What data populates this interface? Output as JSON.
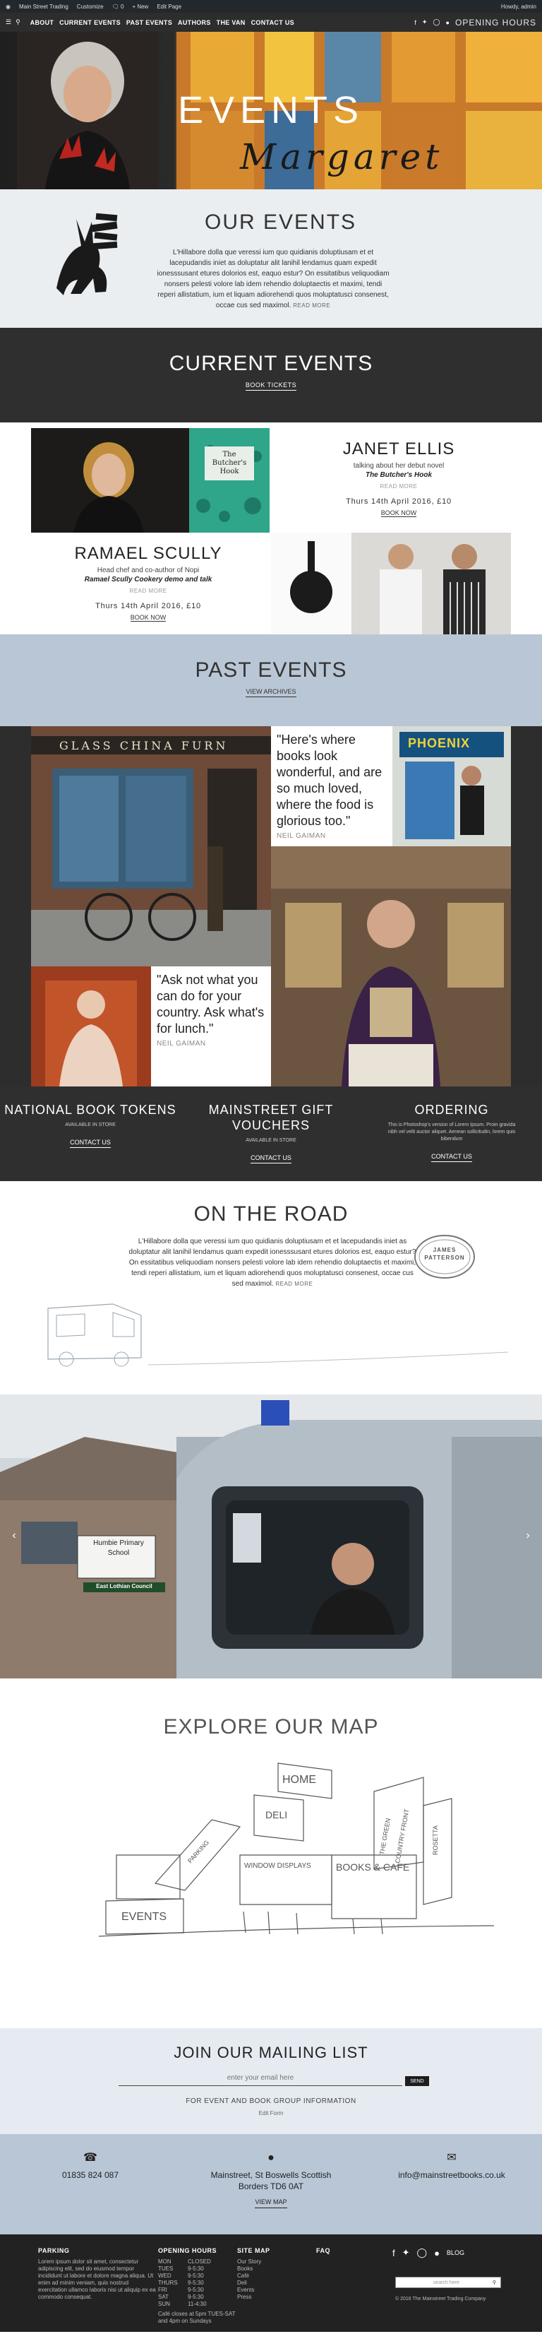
{
  "adminbar": {
    "site": "Main Street Trading",
    "customize": "Customize",
    "comments": "0",
    "new": "+ New",
    "edit": "Edit Page",
    "howdy": "Howdy, admin"
  },
  "nav": {
    "items": [
      "ABOUT",
      "CURRENT EVENTS",
      "PAST EVENTS",
      "AUTHORS",
      "THE VAN",
      "CONTACT US"
    ],
    "hours": "OPENING HOURS"
  },
  "hero": {
    "title": "EVENTS",
    "script": "Margaret"
  },
  "our_events": {
    "title": "OUR EVENTS",
    "body": "L'Hillabore dolla que veressi ium quo quidianis doluptiusam et et lacepudandis iniet as doluptatur alit lanihil lendamus quam expedit ionesssusant etures dolorios est, eaquo estur? On essitatibus veliquodiam nonsers pelesti volore lab idem rehendio doluptaectis et maximi, tendi reperi allistatium, ium et liquam adiorehendi quos moluptatusci consenest, occae cus sed maximol.",
    "read_more": "READ MORE"
  },
  "current": {
    "title": "CURRENT EVENTS",
    "link": "BOOK TICKETS",
    "events": [
      {
        "name": "JANET ELLIS",
        "sub": "talking about her debut novel",
        "book": "The Butcher's Hook",
        "more": "READ MORE",
        "date": "Thurs 14th April 2016, £10",
        "book_now": "BOOK NOW",
        "cover": "The Butcher's Hook"
      },
      {
        "name": "RAMAEL SCULLY",
        "sub": "Head chef and co-author of Nopi",
        "book": "Ramael Scully Cookery demo and talk",
        "more": "READ MORE",
        "date": "Thurs 14th April 2016, £10",
        "book_now": "BOOK NOW"
      }
    ]
  },
  "past": {
    "title": "PAST EVENTS",
    "link": "VIEW ARCHIVES",
    "quotes": [
      {
        "q": "\"Here's where books look wonderful, and are so much loved, where the food is glorious too.\"",
        "who": "NEIL GAIMAN"
      },
      {
        "q": "\"Ask not what you can do for your country. Ask what's for lunch.\"",
        "who": "NEIL GAIMAN"
      }
    ],
    "shop_sign": "GLASS CHINA FURN",
    "phoenix": "PHOENIX"
  },
  "tokens": [
    {
      "title": "NATIONAL BOOK TOKENS",
      "small": "AVAILABLE IN STORE",
      "contact": "CONTACT US"
    },
    {
      "title": "MAINSTREET GIFT VOUCHERS",
      "small": "AVAILABLE IN STORE",
      "contact": "CONTACT US"
    },
    {
      "title": "ORDERING",
      "small": "This is Photoshop's version of Lorem Ipsum. Proin gravida nibh vel velit auctor aliquet. Aenean sollicitudin, lorem quis bibendum",
      "contact": "CONTACT US"
    }
  ],
  "road": {
    "title": "ON THE ROAD",
    "body": "L'Hillabore dolla que veressi ium quo quidianis doluptiusam et et lacepudandis iniet as doluptatur alit lanihil lendamus quam expedit ionesssusant etures dolorios est, eaquo estur? On essitatibus veliquodiam nonsers pelesti volore lab idem rehendio doluptaectis et maximi, tendi reperi allistatium, ium et liquam adiorehendi quos moluptatusci consenest, occae cus sed maximol.",
    "read_more": "READ MORE",
    "stamp": "JAMES PATTERSON",
    "school_sign": "Humbie Primary School",
    "council_sign": "East Lothian Council"
  },
  "map": {
    "title": "EXPLORE OUR MAP",
    "labels": [
      "HOME",
      "DELI",
      "WINDOW DISPLAYS",
      "BOOKS & CAFE",
      "EVENTS",
      "PARKING",
      "THE GREEN",
      "COUNTRY FRONT",
      "ROSETTA"
    ]
  },
  "mailing": {
    "title": "JOIN OUR MAILING LIST",
    "placeholder": "enter your email here",
    "send": "SEND",
    "group": "FOR EVENT AND BOOK GROUP INFORMATION",
    "edit": "Edit Form"
  },
  "contact": {
    "phone": "01835 824 087",
    "address1": "Mainstreet, St Boswells Scottish",
    "address2": "Borders TD6 0AT",
    "view_map": "VIEW MAP",
    "email": "info@mainstreetbooks.co.uk"
  },
  "footer": {
    "parking_title": "PARKING",
    "parking_text": "Lorem ipsum dolor sit amet, consectetur adipiscing elit, sed do eiusmod tempor incididunt ut labore et dolore magna aliqua. Ut enim ad minim veniam, quis nostrud exercitation ullamco laboris nisi ut aliquip ex ea commodo consequat.",
    "hours_title": "OPENING HOURS",
    "hours": [
      [
        "MON",
        "CLOSED"
      ],
      [
        "TUES",
        "9-5:30"
      ],
      [
        "WED",
        "9-5:30"
      ],
      [
        "THURS",
        "9-5:30"
      ],
      [
        "FRI",
        "9-5:30"
      ],
      [
        "SAT",
        "9-5:30"
      ],
      [
        "SUN",
        "11-4:30"
      ]
    ],
    "hours_note": "Café closes at 5pm TUES-SAT and 4pm on Sundays",
    "sitemap_title": "SITE MAP",
    "sitemap": [
      "Our Story",
      "Books",
      "Café",
      "Deli",
      "Events",
      "Press"
    ],
    "faq_title": "FAQ",
    "blog": "BLOG",
    "search_placeholder": "search here",
    "copyright": "© 2016 The Mainstreet Trading Company"
  }
}
